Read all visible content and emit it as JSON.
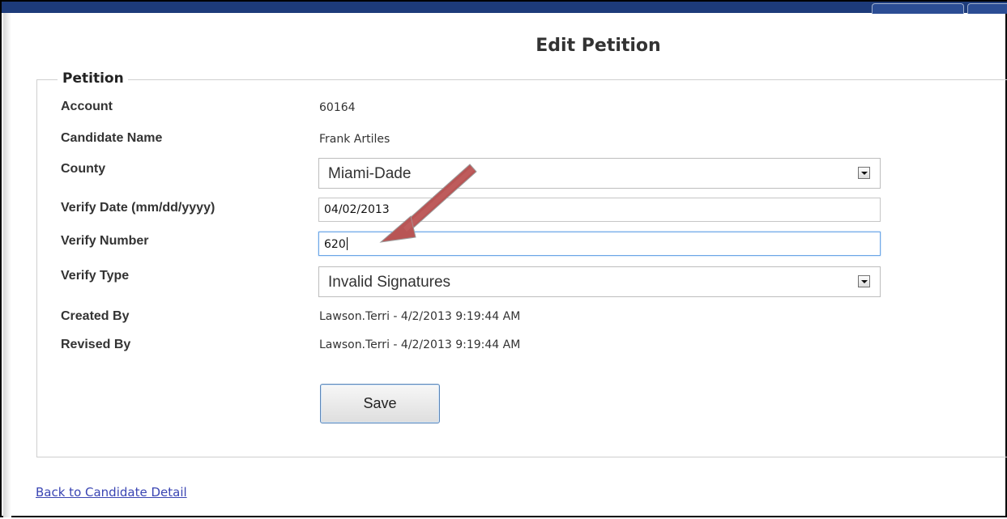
{
  "page": {
    "title": "Edit Petition"
  },
  "petition": {
    "legend": "Petition",
    "fields": {
      "account_label": "Account",
      "account_value": "60164",
      "candidate_label": "Candidate Name",
      "candidate_value": "Frank Artiles",
      "county_label": "County",
      "county_value": "Miami-Dade",
      "verify_date_label": "Verify Date (mm/dd/yyyy)",
      "verify_date_value": "04/02/2013",
      "verify_number_label": "Verify Number",
      "verify_number_value": "620",
      "verify_type_label": "Verify Type",
      "verify_type_value": "Invalid Signatures",
      "created_by_label": "Created By",
      "created_by_value": "Lawson.Terri - 4/2/2013 9:19:44 AM",
      "revised_by_label": "Revised By",
      "revised_by_value": "Lawson.Terri - 4/2/2013 9:19:44 AM"
    },
    "save_label": "Save"
  },
  "footer": {
    "back_link": "Back to Candidate Detail"
  },
  "colors": {
    "header_bar": "#1d3b7a",
    "link": "#3a45b3",
    "arrow": "#b04a4a",
    "focus_border": "#6aa5e6"
  }
}
